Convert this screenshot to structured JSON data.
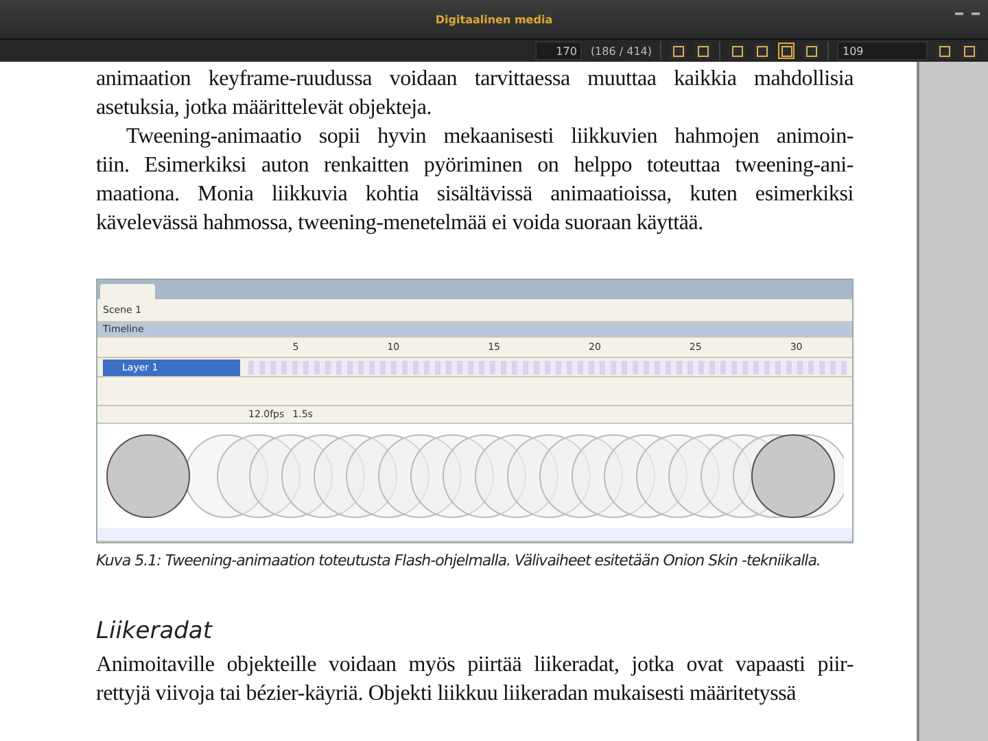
{
  "window": {
    "title": "Digitaalinen media"
  },
  "toolbar": {
    "page_input": "170",
    "page_count": "(186 / 414)",
    "zoom_input": "109"
  },
  "page": {
    "paragraphs": [
      {
        "indent": false,
        "lines": [
          "animaation keyframe-ruudussa voidaan tarvittaessa muuttaa kaikkia mahdollisia",
          "asetuksia, jotka määrittelevät objekteja."
        ]
      },
      {
        "indent": true,
        "lines": [
          "Tweening-animaatio sopii hyvin mekaanisesti liikkuvien hahmojen animoin-",
          "tiin. Esimerkiksi auton renkaitten pyöriminen on helppo toteuttaa tweening-ani-",
          "maationa. Monia liikkuvia kohtia sisältävissä animaatioissa, kuten esimerkiksi",
          "kävelevässä hahmossa, tweening-menetelmää ei voida suoraan käyttää."
        ]
      }
    ],
    "figure": {
      "toolbar_label": "Scene 1",
      "panel_title": "Timeline",
      "layer": {
        "name": "Layer 1",
        "selected": true
      },
      "ruler": [
        "5",
        "10",
        "15",
        "20",
        "25",
        "30"
      ],
      "fps": "12.0fps",
      "time": "1.5s",
      "caption": "Kuva 5.1: Tweening-animaation toteutusta Flash-ohjelmalla. Välivaiheet esitetään Onion Skin -tekniikalla."
    },
    "heading": "Liikeradat",
    "paragraphs2": [
      {
        "indent": false,
        "lines": [
          "Animoitaville objekteille voidaan myös piirtää liikeradat, jotka ovat vapaasti piir-",
          "rettyjä viivoja tai bézier-käyriä. Objekti liikkuu liikeradan mukaisesti määritetyssä"
        ]
      }
    ]
  }
}
